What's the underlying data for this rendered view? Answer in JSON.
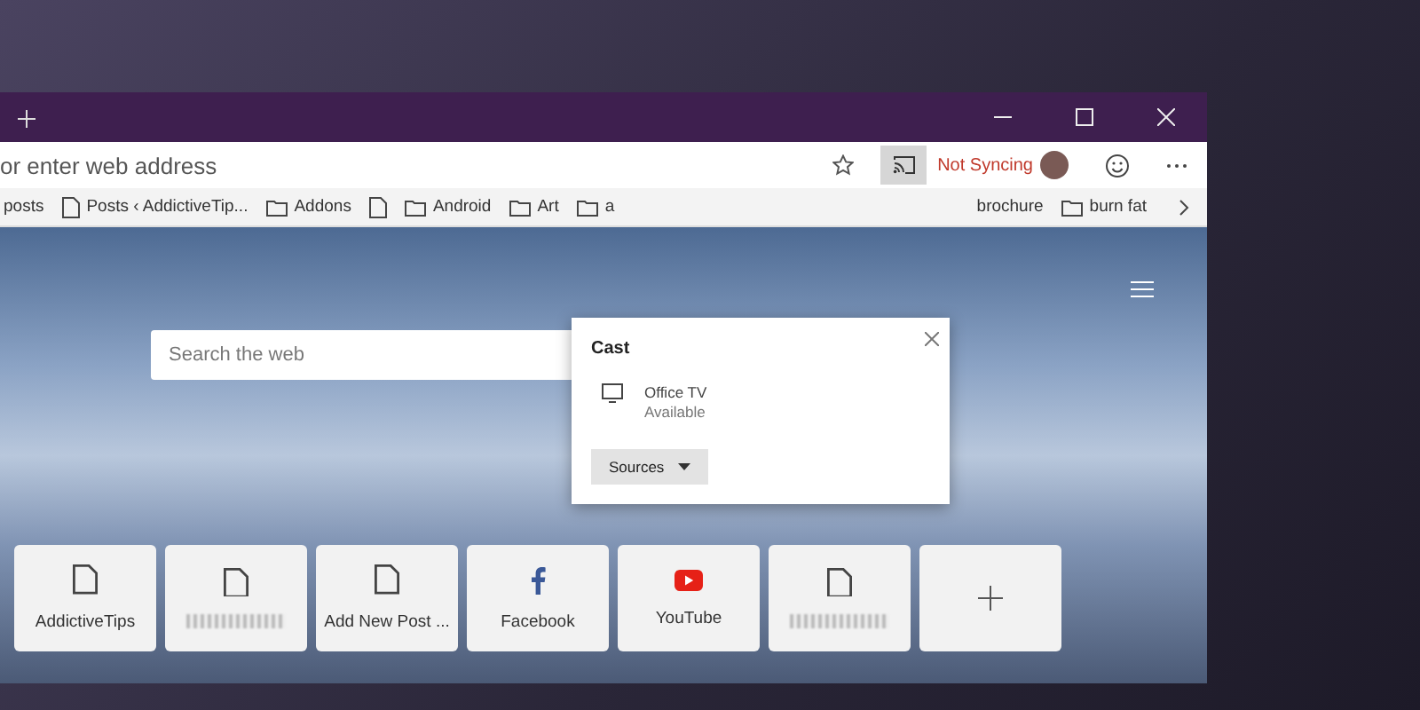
{
  "address_bar": {
    "placeholder": "or enter web address",
    "favorite": false
  },
  "profile": {
    "sync_status": "Not Syncing"
  },
  "bookmarks": [
    {
      "kind": "text",
      "label": "posts"
    },
    {
      "kind": "page",
      "label": "Posts ‹ AddictiveTip..."
    },
    {
      "kind": "folder",
      "label": "Addons"
    },
    {
      "kind": "page"
    },
    {
      "kind": "folder",
      "label": "Android"
    },
    {
      "kind": "folder",
      "label": "Art"
    },
    {
      "kind": "folder",
      "label": "a"
    },
    {
      "kind": "text",
      "label": "brochure"
    },
    {
      "kind": "folder",
      "label": "burn fat"
    }
  ],
  "search": {
    "placeholder": "Search the web"
  },
  "cast_popup": {
    "title": "Cast",
    "devices": [
      {
        "name": "Office TV",
        "status": "Available"
      }
    ],
    "sources_button": "Sources"
  },
  "top_sites": [
    {
      "kind": "page",
      "label": "AddictiveTips"
    },
    {
      "kind": "page",
      "blurred": true
    },
    {
      "kind": "page",
      "label": "Add New Post ..."
    },
    {
      "kind": "facebook",
      "label": "Facebook"
    },
    {
      "kind": "youtube",
      "label": "YouTube"
    },
    {
      "kind": "page",
      "blurred": true
    },
    {
      "kind": "add"
    }
  ]
}
